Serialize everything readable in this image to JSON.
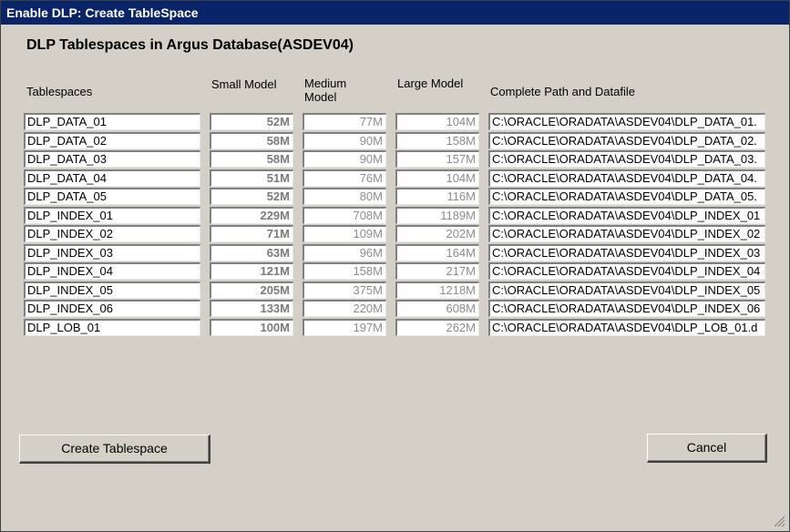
{
  "window": {
    "title": "Enable DLP: Create TableSpace"
  },
  "heading": "DLP Tablespaces in Argus Database(ASDEV04)",
  "columns": {
    "tablespaces": "Tablespaces",
    "small": "Small Model",
    "medium": "Medium Model",
    "large": "Large Model",
    "path": "Complete Path and Datafile"
  },
  "rows": [
    {
      "name": "DLP_DATA_01",
      "small": "52M",
      "medium": "77M",
      "large": "104M",
      "path": "C:\\ORACLE\\ORADATA\\ASDEV04\\DLP_DATA_01."
    },
    {
      "name": "DLP_DATA_02",
      "small": "58M",
      "medium": "90M",
      "large": "158M",
      "path": "C:\\ORACLE\\ORADATA\\ASDEV04\\DLP_DATA_02."
    },
    {
      "name": "DLP_DATA_03",
      "small": "58M",
      "medium": "90M",
      "large": "157M",
      "path": "C:\\ORACLE\\ORADATA\\ASDEV04\\DLP_DATA_03."
    },
    {
      "name": "DLP_DATA_04",
      "small": "51M",
      "medium": "76M",
      "large": "104M",
      "path": "C:\\ORACLE\\ORADATA\\ASDEV04\\DLP_DATA_04."
    },
    {
      "name": "DLP_DATA_05",
      "small": "52M",
      "medium": "80M",
      "large": "116M",
      "path": "C:\\ORACLE\\ORADATA\\ASDEV04\\DLP_DATA_05."
    },
    {
      "name": "DLP_INDEX_01",
      "small": "229M",
      "medium": "708M",
      "large": "1189M",
      "path": "C:\\ORACLE\\ORADATA\\ASDEV04\\DLP_INDEX_01"
    },
    {
      "name": "DLP_INDEX_02",
      "small": "71M",
      "medium": "109M",
      "large": "202M",
      "path": "C:\\ORACLE\\ORADATA\\ASDEV04\\DLP_INDEX_02"
    },
    {
      "name": "DLP_INDEX_03",
      "small": "63M",
      "medium": "96M",
      "large": "164M",
      "path": "C:\\ORACLE\\ORADATA\\ASDEV04\\DLP_INDEX_03"
    },
    {
      "name": "DLP_INDEX_04",
      "small": "121M",
      "medium": "158M",
      "large": "217M",
      "path": "C:\\ORACLE\\ORADATA\\ASDEV04\\DLP_INDEX_04"
    },
    {
      "name": "DLP_INDEX_05",
      "small": "205M",
      "medium": "375M",
      "large": "1218M",
      "path": "C:\\ORACLE\\ORADATA\\ASDEV04\\DLP_INDEX_05"
    },
    {
      "name": "DLP_INDEX_06",
      "small": "133M",
      "medium": "220M",
      "large": "608M",
      "path": "C:\\ORACLE\\ORADATA\\ASDEV04\\DLP_INDEX_06"
    },
    {
      "name": "DLP_LOB_01",
      "small": "100M",
      "medium": "197M",
      "large": "262M",
      "path": "C:\\ORACLE\\ORADATA\\ASDEV04\\DLP_LOB_01.d"
    }
  ],
  "buttons": {
    "create": "Create Tablespace",
    "cancel": "Cancel"
  },
  "icons": {
    "resize_grip": "resize-grip-icon"
  },
  "colors": {
    "titlebar": "#0a246a",
    "dialog_bg": "#d4d0c8"
  }
}
